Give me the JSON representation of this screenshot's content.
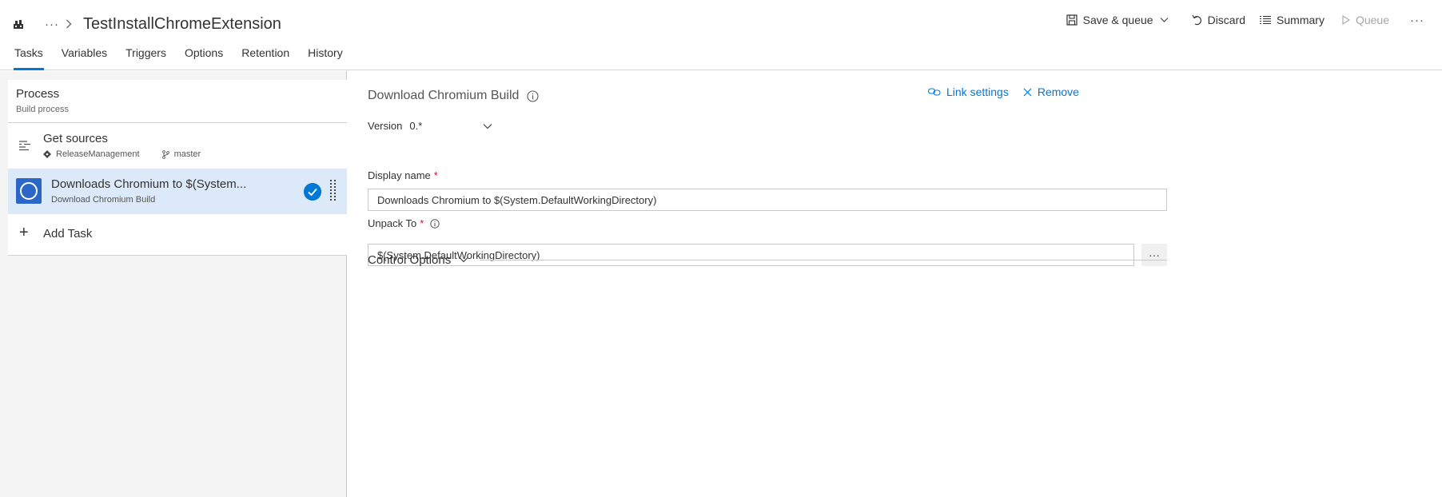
{
  "header": {
    "breadcrumb_more": "···",
    "pipeline_title": "TestInstallChromeExtension",
    "toolbar": {
      "save_queue": "Save & queue",
      "discard": "Discard",
      "summary": "Summary",
      "queue": "Queue",
      "more": "···"
    },
    "tabs": [
      "Tasks",
      "Variables",
      "Triggers",
      "Options",
      "Retention",
      "History"
    ],
    "active_tab": "Tasks"
  },
  "left_panel": {
    "process": {
      "title": "Process",
      "subtitle": "Build process"
    },
    "get_sources": {
      "title": "Get sources",
      "repo": "ReleaseManagement",
      "branch": "master"
    },
    "task": {
      "title": "Downloads Chromium to $(System...",
      "subtitle": "Download Chromium Build",
      "enabled": true
    },
    "add_task": "Add Task"
  },
  "detail": {
    "title": "Download Chromium Build",
    "link_settings": "Link settings",
    "remove": "Remove",
    "version_label": "Version",
    "version_value": "0.*",
    "display_name_label": "Display name",
    "display_name_value": "Downloads Chromium to $(System.DefaultWorkingDirectory)",
    "unpack_to_label": "Unpack To",
    "unpack_to_value": "$(System.DefaultWorkingDirectory)",
    "browse": "···",
    "required_marker": "*",
    "control_options": "Control Options"
  },
  "colors": {
    "accent": "#0078d4",
    "selected_row": "#dbe9f8",
    "panel_bg": "#f4f4f4",
    "required": "#c8102e",
    "disabled": "#a6a6a6"
  }
}
